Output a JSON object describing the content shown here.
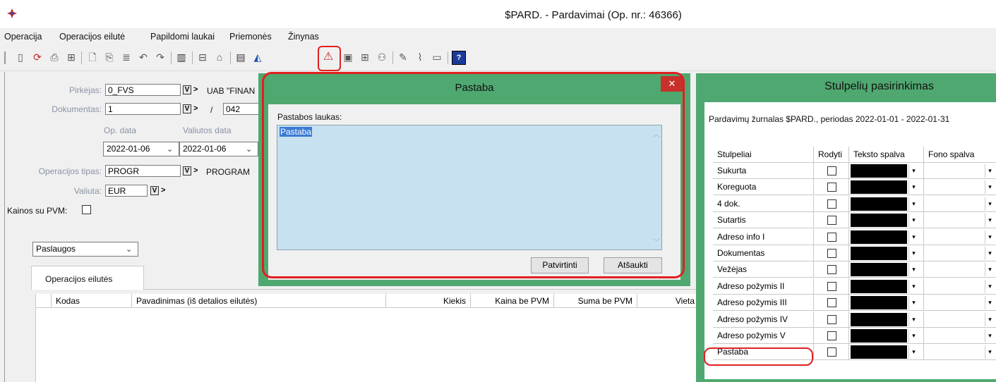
{
  "window": {
    "title": "$PARD. - Pardavimai (Op. nr.: 46366)"
  },
  "menu": [
    "Operacija",
    "Operacijos eilutė",
    "Papildomi laukai",
    "Priemonės",
    "Žinynas"
  ],
  "form": {
    "buyer_label": "Pirkėjas:",
    "buyer_code": "0_FVS",
    "buyer_name": "UAB \"FINAN",
    "document_label": "Dokumentas:",
    "document_value": "1",
    "document_slash": "/",
    "document_number": "042",
    "op_date_label": "Op. data",
    "currency_date_label": "Valiutos data",
    "op_date": "2022-01-06",
    "currency_date": "2022-01-06",
    "op_type_label": "Operacijos tipas:",
    "op_type": "PROGR",
    "op_type_name": "PROGRAM",
    "currency_label": "Valiuta:",
    "currency": "EUR",
    "prices_vat_label": "Kainos su PVM:",
    "services_select": "Paslaugos",
    "tab_label": "Operacijos eilutės"
  },
  "grid": {
    "columns": [
      "Kodas",
      "Pavadinimas (iš detalios eilutės)",
      "Kiekis",
      "Kaina be PVM",
      "Suma be PVM",
      "Vieta"
    ]
  },
  "dialog": {
    "title": "Pastaba",
    "close": "✕",
    "field_label": "Pastabos laukas:",
    "text": "Pastaba",
    "confirm": "Patvirtinti",
    "cancel": "Atšaukti"
  },
  "columns_panel": {
    "title": "Stulpelių pasirinkimas",
    "caption": "Pardavimų žurnalas $PARD., periodas 2022-01-01 - 2022-01-31",
    "headers": [
      "Stulpeliai",
      "Rodyti",
      "Teksto spalva",
      "Fono spalva"
    ],
    "rows": [
      "Sukurta",
      "Koreguota",
      "4 dok.",
      "Sutartis",
      "Adreso info I",
      "Dokumentas",
      "Vežėjas",
      "Adreso požymis II",
      "Adreso požymis III",
      "Adreso požymis IV",
      "Adreso požymis V",
      "Pastaba"
    ]
  },
  "colors": {
    "dialog_frame": "#4fa870",
    "highlight": "#e02020",
    "text_area": "#c8e1f0",
    "close_button": "#c7302b"
  }
}
